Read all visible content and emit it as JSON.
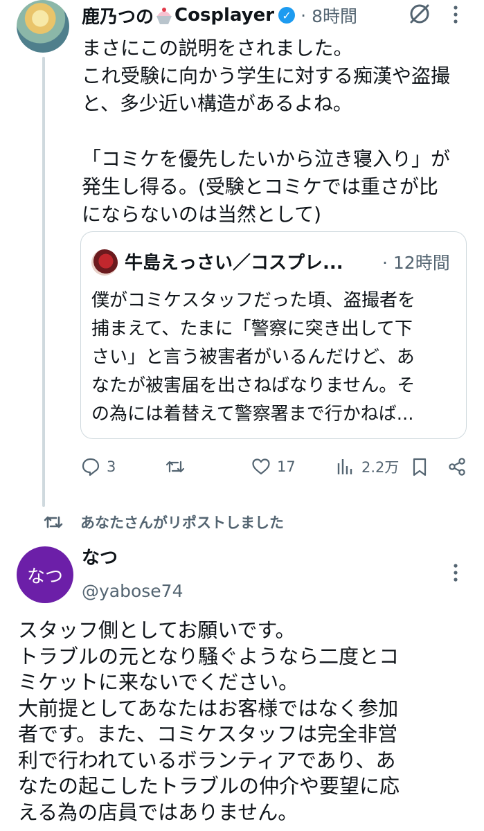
{
  "tweet1": {
    "display_name": "鹿乃つの",
    "display_name_suffix": "Cosplayer",
    "emoji_icon": "shaved-ice-emoji",
    "verified_badge": "✓",
    "more_dots": "·",
    "time": "8時間",
    "text": "まさにこの説明をされました。\nこれ受験に向かう学生に対する痴漢や盗撮\nと、多少近い構造があるよね。\n\n「コミケを優先したいから泣き寝入り」が\n発生し得る。(受験とコミケでは重さが比\nにならないのは当然として)",
    "quote": {
      "display_name": "牛島えっさい／コスプレ...",
      "time": "· 12時間",
      "text": "僕がコミケスタッフだった頃、盗撮者を\n捕まえて、たまに「警察に突き出して下\nさい」と言う被害者がいるんだけど、あ\nなたが被害届を出さねばなりません。そ\nの為には着替えて警察署まで行かねば..."
    },
    "actions": {
      "reply_count": "3",
      "retweet_count": "",
      "like_count": "17",
      "views_count": "2.2万"
    }
  },
  "repost_label": "あなたさんがリポストしました",
  "tweet2": {
    "avatar_text": "なつ",
    "display_name": "なつ",
    "handle": "@yabose74",
    "text": "スタッフ側としてお願いです。\nトラブルの元となり騒ぐようなら二度とコ\nミケットに来ないでください。\n大前提としてあなたはお客様ではなく参加\n者です。また、コミケスタッフは完全非営\n利で行われているボランティアであり、あ\nなたの起こしたトラブルの仲介や要望に応\nえる為の店員ではありません。"
  },
  "colors": {
    "text": "#0f1419",
    "secondary": "#536471",
    "verified": "#1d9bf0",
    "avatar2_bg": "#6c1fa8",
    "border": "#cfd9de"
  },
  "icons": [
    "reply-icon",
    "retweet-icon",
    "like-icon",
    "views-icon",
    "bookmark-icon",
    "share-icon",
    "grok-icon",
    "more-icon"
  ]
}
